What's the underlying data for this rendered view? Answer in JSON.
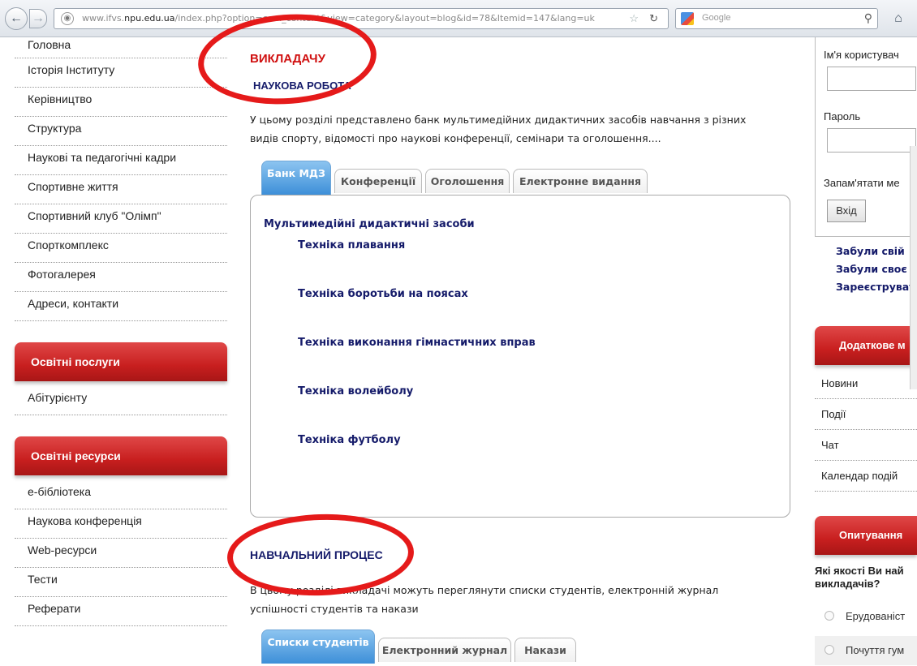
{
  "browser": {
    "url_prefix": "www.ifvs.",
    "url_domain": "npu.edu.ua",
    "url_rest": "/index.php?option=com_content&view=category&layout=blog&id=78&Itemid=147&lang=uk",
    "search_placeholder": "Google"
  },
  "left_nav": {
    "main_items": [
      "Головна",
      "Історія Інституту",
      "Керівництво",
      "Структура",
      "Наукові та педагогічні кадри",
      "Спортивне життя",
      "Спортивний клуб \"Олімп\"",
      "Спорткомплекс",
      "Фотогалерея",
      "Адреси, контакти"
    ],
    "module1_title": "Освітні послуги",
    "module1_items": [
      "Абітурієнту"
    ],
    "module2_title": "Освітні ресурси",
    "module2_items": [
      "е-бібліотека",
      "Наукова конференція",
      "Web-ресурси",
      "Тести",
      "Реферати"
    ]
  },
  "main": {
    "section_title": "ВИКЛАДАЧУ",
    "science_title": "НАУКОВА РОБОТА",
    "science_intro_1": "У цьому розділі представлено банк мультимедійних дидактичних засобів навчання з різних",
    "science_intro_2": "видів спорту, відомості про наукові конференції, семінари та оголошення....",
    "science_tabs": [
      "Банк МДЗ",
      "Конференції",
      "Оголошення",
      "Електронне видання"
    ],
    "mdz_heading": "Мультимедійні дидактичні засоби",
    "mdz_links": [
      "Техніка плавання",
      "Техніка боротьби на поясах",
      "Техніка виконання гімнастичних вправ",
      "Техніка волейболу",
      "Техніка футболу"
    ],
    "process_title": "НАВЧАЛЬНИЙ ПРОЦЕС",
    "process_intro_1": "В цьому розділі викладачі можуть переглянути списки студентів, електронній журнал",
    "process_intro_2": "успішності студентів та накази",
    "process_tabs": [
      "Списки студентів",
      "Електронний журнал",
      "Накази"
    ]
  },
  "right": {
    "username_label": "Ім'я користувач",
    "password_label": "Пароль",
    "remember_label": "Запам'ятати ме",
    "login_button": "Вхід",
    "links": [
      "Забули свій",
      "Забули своє",
      "Зареєструват"
    ],
    "extra_menu_title": "Додаткове м",
    "extra_items": [
      "Новини",
      "Події",
      "Чат",
      "Календар подій"
    ],
    "poll_title": "Опитування",
    "poll_question_1": "Які якості Ви най",
    "poll_question_2": "викладачів?",
    "poll_options": [
      "Ерудованіст",
      "Почуття гум"
    ]
  },
  "colors": {
    "accent_red": "#c81f1f",
    "link_blue": "#151b6a",
    "tab_blue": "#3d8fd8",
    "annotation_red": "#e51a1a"
  }
}
